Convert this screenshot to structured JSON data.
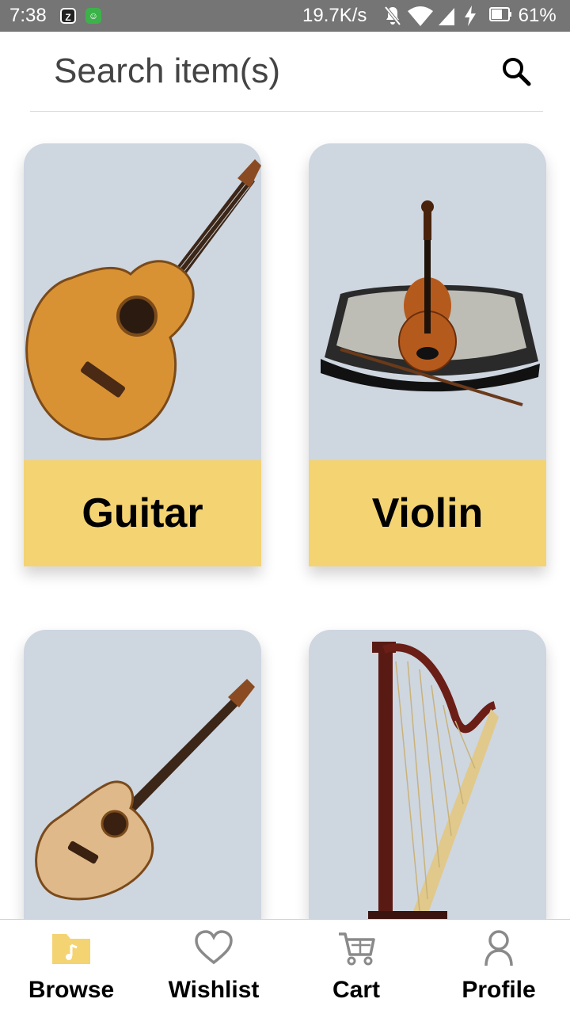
{
  "status_bar": {
    "time": "7:38",
    "network_speed": "19.7K/s",
    "battery": "61%"
  },
  "search": {
    "placeholder": "Search item(s)",
    "value": ""
  },
  "products": [
    {
      "name": "Guitar",
      "image": "guitar-image"
    },
    {
      "name": "Violin",
      "image": "violin-image"
    },
    {
      "name": "",
      "image": "acoustic-bass-guitar-image"
    },
    {
      "name": "",
      "image": "harp-image"
    }
  ],
  "bottom_nav": {
    "items": [
      {
        "label": "Browse",
        "icon": "folder-music-icon",
        "active": true
      },
      {
        "label": "Wishlist",
        "icon": "heart-icon",
        "active": false
      },
      {
        "label": "Cart",
        "icon": "cart-icon",
        "active": false
      },
      {
        "label": "Profile",
        "icon": "user-icon",
        "active": false
      }
    ]
  },
  "colors": {
    "card_background": "#ced6e0",
    "label_background": "#f4d373",
    "active_nav": "#f4d373",
    "inactive_nav_icon": "#8a8a8a",
    "status_bar": "#757575"
  }
}
